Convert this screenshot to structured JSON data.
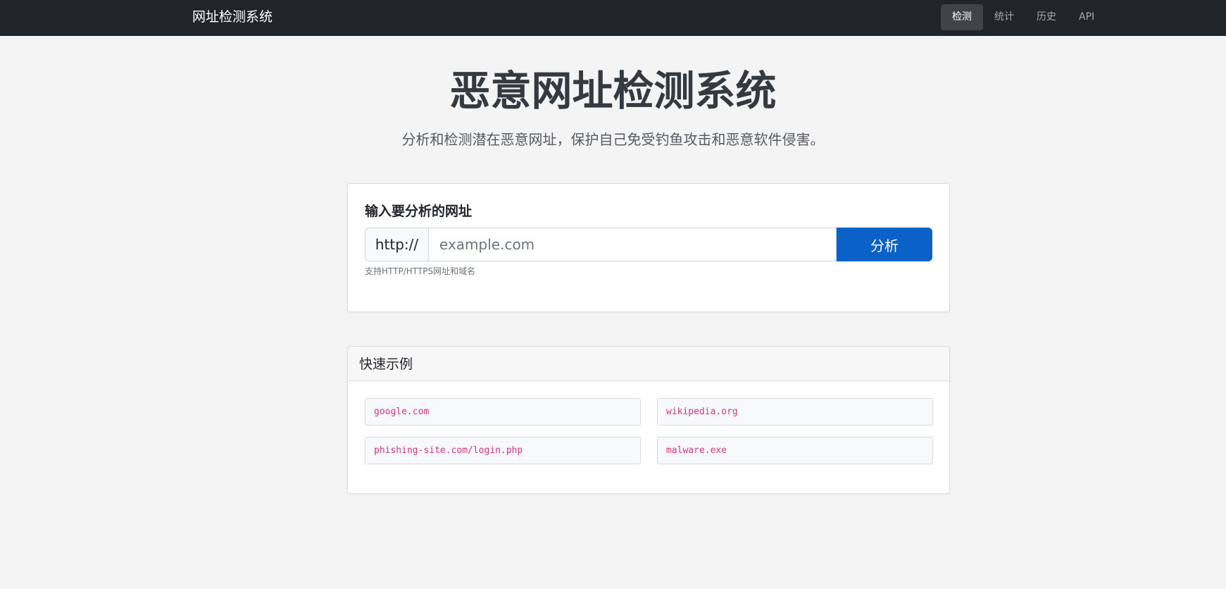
{
  "navbar": {
    "brand": "网址检测系统",
    "links": [
      {
        "label": "检测",
        "active": true
      },
      {
        "label": "统计",
        "active": false
      },
      {
        "label": "历史",
        "active": false
      },
      {
        "label": "API",
        "active": false
      }
    ]
  },
  "hero": {
    "title": "恶意网址检测系统",
    "subtitle": "分析和检测潜在恶意网址，保护自己免受钓鱼攻击和恶意软件侵害。"
  },
  "analyze_form": {
    "label": "输入要分析的网址",
    "prefix": "http://",
    "placeholder": "example.com",
    "value": "",
    "button_label": "分析",
    "help_text": "支持HTTP/HTTPS网址和域名"
  },
  "examples": {
    "header": "快速示例",
    "items": [
      "google.com",
      "wikipedia.org",
      "phishing-site.com/login.php",
      "malware.exe"
    ]
  },
  "colors": {
    "navbar_bg": "#212529",
    "primary": "#0a62c9",
    "example_text": "#d63384",
    "page_bg": "#f4f4f4"
  }
}
